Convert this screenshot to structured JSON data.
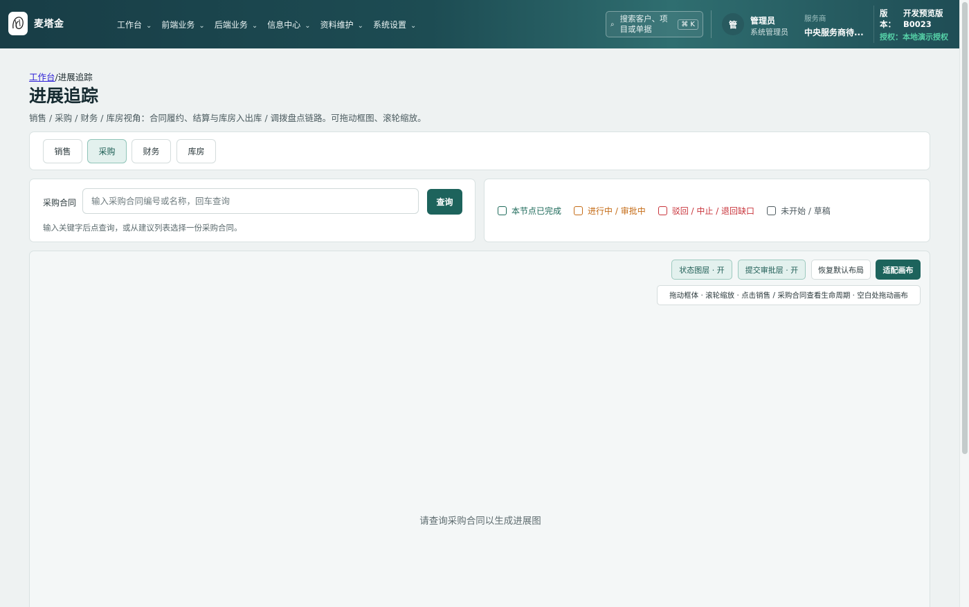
{
  "header": {
    "brand": "麦塔金",
    "nav": [
      {
        "label": "工作台"
      },
      {
        "label": "前端业务"
      },
      {
        "label": "后端业务"
      },
      {
        "label": "信息中心"
      },
      {
        "label": "资料维护"
      },
      {
        "label": "系统设置"
      }
    ],
    "search": {
      "placeholder": "搜索客户、项目或单据",
      "shortcut": "⌘ K"
    },
    "user": {
      "avatar": "管",
      "name": "管理员",
      "role": "系统管理员"
    },
    "service_provider": {
      "label": "服务商",
      "value": "中央服务商待..."
    },
    "version": {
      "label": "版本：",
      "value": "开发预览版 B0023"
    },
    "license": {
      "label": "授权：",
      "value": "本地演示授权"
    }
  },
  "breadcrumb": {
    "home": "工作台",
    "separator": "/",
    "current": "进展追踪"
  },
  "page": {
    "title": "进展追踪",
    "description": "销售 / 采购 / 财务 / 库房视角：合同履约、结算与库房入出库 / 调拨盘点链路。可拖动框图、滚轮缩放。"
  },
  "tabs": [
    {
      "label": "销售",
      "active": false
    },
    {
      "label": "采购",
      "active": true
    },
    {
      "label": "财务",
      "active": false
    },
    {
      "label": "库房",
      "active": false
    }
  ],
  "query": {
    "label": "采购合同",
    "placeholder": "输入采购合同编号或名称，回车查询",
    "value": "",
    "button": "查询",
    "hint": "输入关键字后点查询，或从建议列表选择一份采购合同。"
  },
  "legend": [
    {
      "label": "本节点已完成",
      "color": "#1e6a5a"
    },
    {
      "label": "进行中 / 审批中",
      "color": "#c46a14"
    },
    {
      "label": "驳回 / 中止 / 退回缺口",
      "color": "#c8333a"
    },
    {
      "label": "未开始 / 草稿",
      "color": "#4f5b60"
    }
  ],
  "canvas": {
    "buttons": {
      "status_layer": "状态图层 · 开",
      "approval_layer": "提交审批层 · 开",
      "reset_layout": "恢复默认布局",
      "fit_canvas": "适配画布"
    },
    "tip": "拖动框体 · 滚轮缩放 · 点击销售 / 采购合同查看生命周期 · 空白处拖动画布",
    "empty_message": "请查询采购合同以生成进展图"
  },
  "colors": {
    "brand_dark": "#183d46",
    "accent": "#1d635c",
    "license_green": "#56d2a8"
  }
}
